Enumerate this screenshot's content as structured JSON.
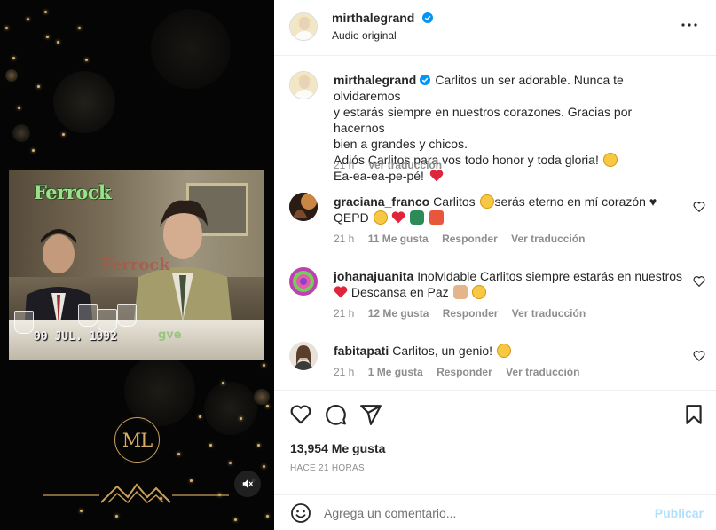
{
  "post": {
    "author": "mirthalegrand",
    "audio_label": "Audio original",
    "verified_color": "#0095f6"
  },
  "video": {
    "overlay_title": "Ferrock",
    "overlay_watermark": "Ferrock",
    "overlay_date": "00 JUL. 1992",
    "overlay_corner": "gve",
    "logo_text": "ML",
    "muted": true
  },
  "caption": {
    "username": "mirthalegrand",
    "lines": [
      "Carlitos un ser adorable. Nunca te olvidaremos",
      "y estarás siempre en nuestros corazones. Gracias por hacernos",
      "bien a grandes y chicos.",
      "Adiós Carlitos para vos todo honor y toda gloria!",
      "Ea-ea-ea-pe-pé!"
    ],
    "time": "21 h",
    "translate": "Ver traducción"
  },
  "comments": [
    {
      "username": "graciana_franco",
      "line1": "Carlitos",
      "line1b": "serás eterno en mí corazón ♥",
      "line2": "QEPD",
      "time": "21 h",
      "likes": "11 Me gusta",
      "reply": "Responder",
      "translate": "Ver traducción"
    },
    {
      "username": "johanajuanita",
      "line1": "Inolvidable Carlitos siempre estarás en nuestros",
      "line2": "Descansa en Paz",
      "time": "21 h",
      "likes": "12 Me gusta",
      "reply": "Responder",
      "translate": "Ver traducción"
    },
    {
      "username": "fabitapati",
      "line1": "Carlitos, un genio!",
      "time": "21 h",
      "likes": "1 Me gusta",
      "reply": "Responder",
      "translate": "Ver traducción"
    }
  ],
  "actions": {
    "likes_count": "13,954 Me gusta",
    "posted_ago": "HACE 21 HORAS"
  },
  "compose": {
    "placeholder": "Agrega un comentario...",
    "publish_label": "Publicar"
  },
  "icons": {
    "more": "more-horizontal-icon",
    "like": "heart-icon",
    "comment": "comment-icon",
    "share": "share-icon",
    "save": "bookmark-icon",
    "emoji": "emoji-icon",
    "mute": "speaker-muted-icon"
  },
  "colors": {
    "accent": "#0095f6",
    "publish_disabled": "#b2dffc",
    "heart_red": "#ed4956",
    "gold": "#c9a15a"
  }
}
